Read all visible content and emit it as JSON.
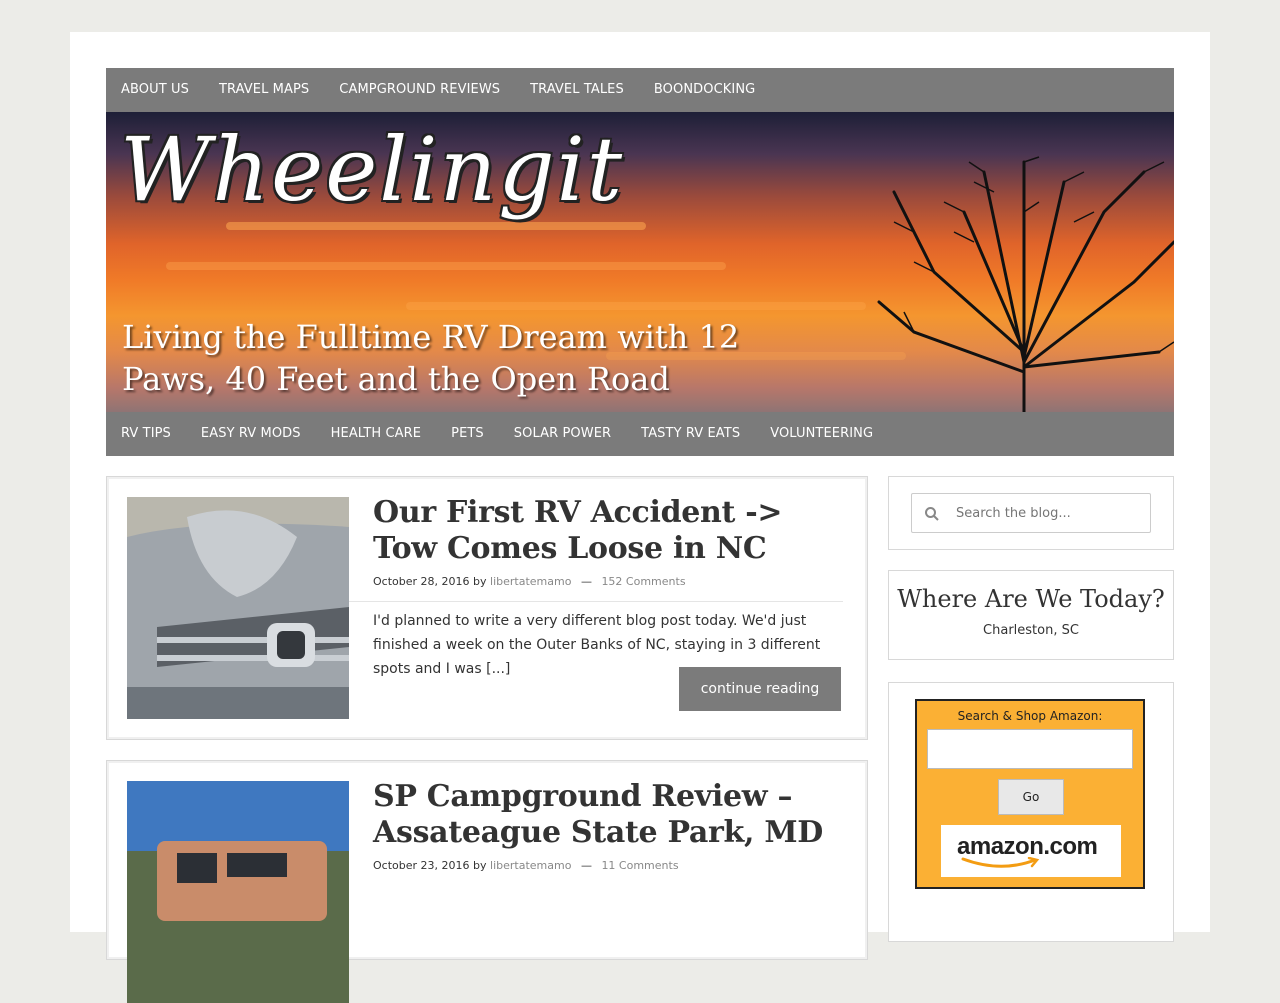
{
  "top_nav": {
    "items": [
      "ABOUT US",
      "TRAVEL MAPS",
      "CAMPGROUND REVIEWS",
      "TRAVEL TALES",
      "BOONDOCKING"
    ]
  },
  "header": {
    "site_title": "Wheelingit",
    "tagline": "Living the Fulltime RV Dream with 12 Paws, 40 Feet and the Open Road"
  },
  "category_nav": {
    "items": [
      "RV TIPS",
      "EASY RV MODS",
      "HEALTH CARE",
      "PETS",
      "SOLAR POWER",
      "TASTY RV EATS",
      "VOLUNTEERING"
    ]
  },
  "posts": [
    {
      "title": "Our First RV Accident -> Tow Comes Loose in NC",
      "date": "October 28, 2016",
      "by": "by",
      "author": "libertatemamo",
      "comments": "152 Comments",
      "excerpt": "I'd planned to write a very different blog post today. We'd just finished a week on the Outer Banks of NC, staying in 3 different spots and I was [...]",
      "continue_label": "continue reading"
    },
    {
      "title": "SP Campground Review – Assateague State Park, MD",
      "date": "October 23, 2016",
      "by": "by",
      "author": "libertatemamo",
      "comments": "11 Comments"
    }
  ],
  "sidebar": {
    "search": {
      "placeholder": "Search the blog..."
    },
    "where": {
      "title": "Where Are We Today?",
      "location": "Charleston, SC"
    },
    "amazon": {
      "label": "Search & Shop Amazon:",
      "go_label": "Go",
      "logo_text": "amazon.com"
    }
  },
  "colors": {
    "nav_bg": "#7b7b7b",
    "amazon_bg": "#fbb034",
    "page_bg": "#ecece8"
  }
}
